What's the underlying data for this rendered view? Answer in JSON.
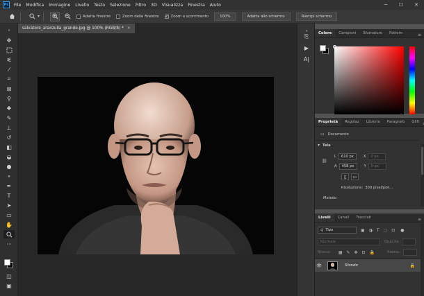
{
  "app": {
    "logo": "Ps"
  },
  "menu": [
    "File",
    "Modifica",
    "Immagine",
    "Livello",
    "Testo",
    "Selezione",
    "Filtro",
    "3D",
    "Visualizza",
    "Finestra",
    "Aiuto"
  ],
  "window_controls": {
    "minimize": "─",
    "maximize": "☐",
    "close": "✕"
  },
  "options": {
    "home_icon": "home-icon",
    "zoom_tool_icon": "zoom-icon",
    "zoom_in_icon": "zoom-in-icon",
    "zoom_out_icon": "zoom-out-icon",
    "resize_windows": "Adatta finestre",
    "zoom_all": "Zoom delle finestre",
    "scrubby_zoom": "Zoom a scorrimento",
    "zoom_percent": "100%",
    "fit_screen": "Adatta allo schermo",
    "fill_screen": "Riempi schermo"
  },
  "document": {
    "tab_title": "salvatore_aranzulla_grande.jpg @ 100% (RGB/8) *",
    "close_glyph": "×"
  },
  "color_panel": {
    "tabs": [
      "Colore",
      "Campioni",
      "Sfumature",
      "Pattern"
    ],
    "active_tab": 0,
    "foreground": "#ffffff",
    "background": "#000000",
    "hue": "#ff0000"
  },
  "properties_panel": {
    "tabs": [
      "Proprietà",
      "Regolaz",
      "Librerie",
      "Paragrafo",
      "Glifi"
    ],
    "active_tab": 0,
    "document_label": "Documento",
    "section_canvas": "Tela",
    "width_label": "L",
    "width_value": "610 px",
    "x_label": "X",
    "x_value": "0 px",
    "height_label": "A",
    "height_value": "458 px",
    "y_label": "Y",
    "y_value": "0 px",
    "resolution_label": "Risoluzione:",
    "resolution_value": "300 pixel/poll...",
    "mode_label": "Metodo"
  },
  "layers_panel": {
    "tabs": [
      "Livelli",
      "Canali",
      "Tracciati"
    ],
    "active_tab": 0,
    "filter_label": "Tipo",
    "blend_mode": "Normale",
    "opacity_label": "Opacità:",
    "lock_label": "Blocca:",
    "fill_label": "Riemp.:",
    "layer_name": "Sfondo"
  }
}
